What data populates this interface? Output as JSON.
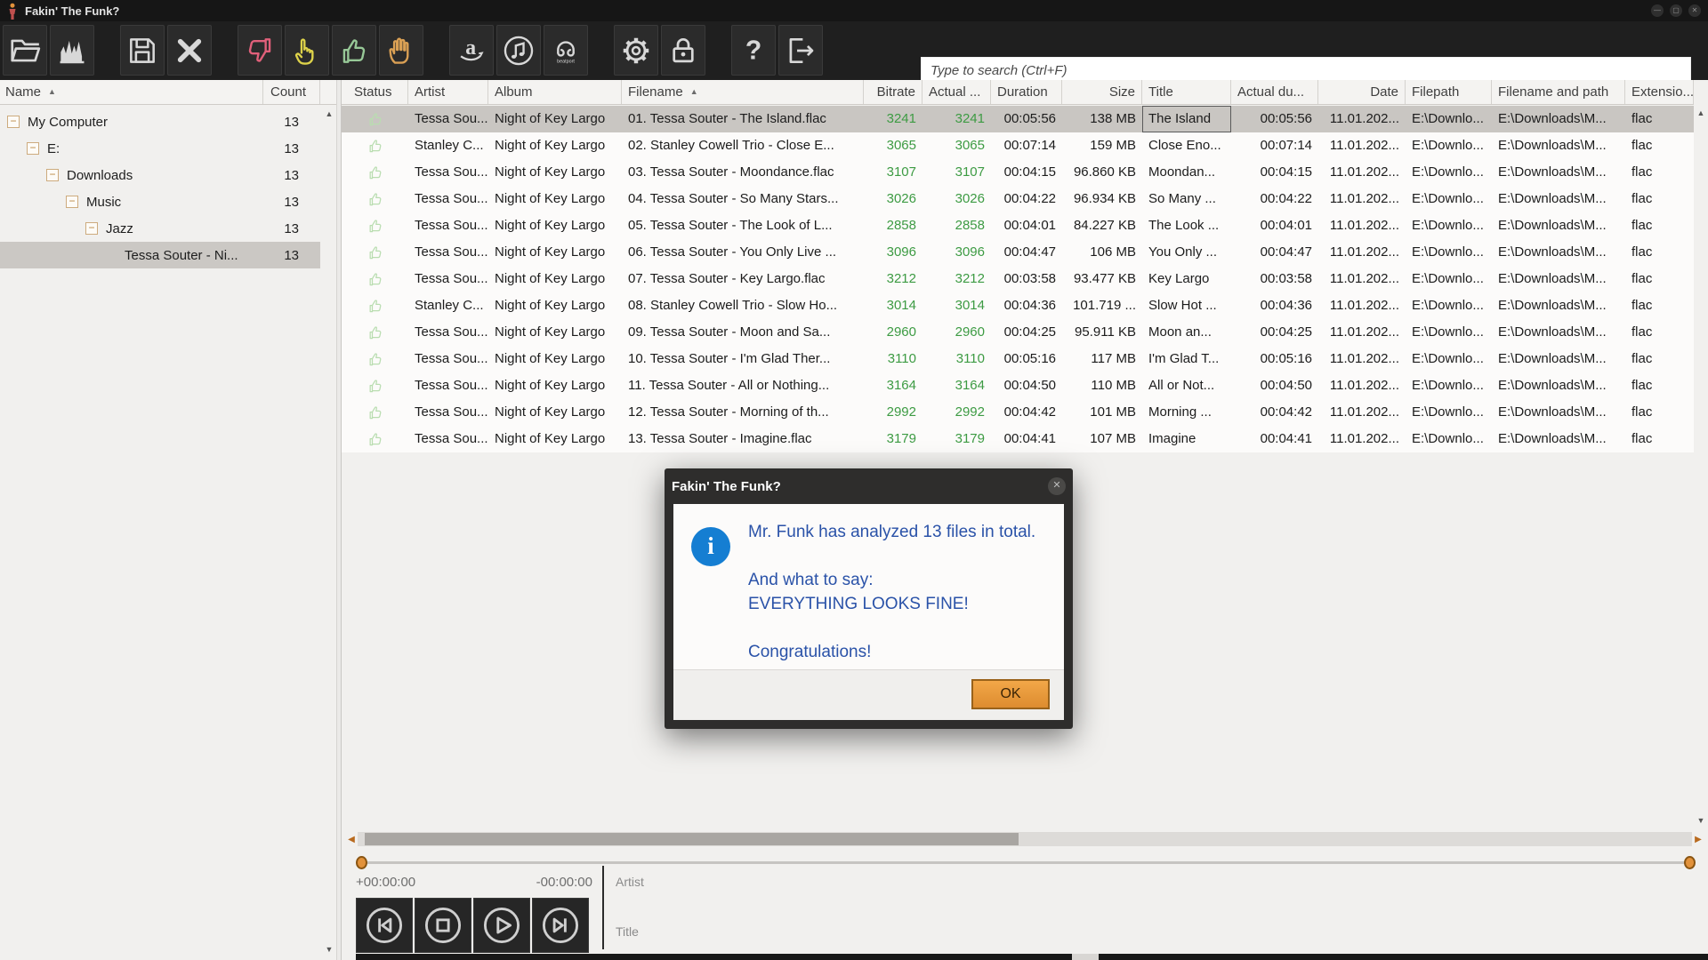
{
  "window": {
    "title": "Fakin' The Funk?",
    "controls": [
      {
        "name": "minimize-button",
        "glyph": "—"
      },
      {
        "name": "maximize-button",
        "glyph": "▢"
      },
      {
        "name": "close-button",
        "glyph": "✕"
      }
    ]
  },
  "glyphs": {
    "sort_asc": "▲",
    "scroll_up": "▲",
    "scroll_down": "▼",
    "scroll_left": "◀",
    "scroll_right": "▶",
    "minus": "−",
    "info": "i",
    "dialog_close": "✕"
  },
  "toolbar": {
    "search": {
      "placeholder": "Type to search (Ctrl+F)",
      "value": ""
    },
    "groups": [
      [
        {
          "name": "open-folder-button",
          "icon": "folder-icon"
        },
        {
          "name": "spectrum-button",
          "icon": "chart-icon"
        }
      ],
      [
        {
          "name": "save-button",
          "icon": "floppy-icon"
        },
        {
          "name": "delete-button",
          "icon": "x-icon"
        }
      ],
      [
        {
          "name": "thumbs-down-button",
          "icon": "thumb-down-icon",
          "color": "#E0607A"
        },
        {
          "name": "pointing-hand-button",
          "icon": "point-hand-icon",
          "color": "#DDD24A"
        },
        {
          "name": "thumbs-up-button",
          "icon": "thumb-up-icon",
          "color": "#97C897"
        },
        {
          "name": "raised-hand-button",
          "icon": "stop-hand-icon",
          "color": "#DAA054"
        }
      ],
      [
        {
          "name": "amazon-button",
          "icon": "amazon-icon"
        },
        {
          "name": "itunes-button",
          "icon": "itunes-icon"
        },
        {
          "name": "beatport-button",
          "icon": "beatport-icon"
        }
      ],
      [
        {
          "name": "settings-button",
          "icon": "gear-icon"
        },
        {
          "name": "lock-button",
          "icon": "lock-icon"
        }
      ],
      [
        {
          "name": "help-button",
          "icon": "help-icon"
        },
        {
          "name": "exit-button",
          "icon": "exit-icon"
        }
      ]
    ]
  },
  "tree": {
    "header": {
      "name": "Name",
      "count": "Count"
    },
    "items": [
      {
        "label": "My Computer",
        "count": "13",
        "level": 0,
        "expandable": true
      },
      {
        "label": "E:",
        "count": "13",
        "level": 1,
        "expandable": true
      },
      {
        "label": "Downloads",
        "count": "13",
        "level": 2,
        "expandable": true
      },
      {
        "label": "Music",
        "count": "13",
        "level": 3,
        "expandable": true
      },
      {
        "label": "Jazz",
        "count": "13",
        "level": 4,
        "expandable": true
      },
      {
        "label": "Tessa Souter - Ni...",
        "count": "13",
        "level": 5,
        "expandable": false,
        "selected": true
      }
    ]
  },
  "table": {
    "columns": [
      {
        "id": "status",
        "label": "Status"
      },
      {
        "id": "artist",
        "label": "Artist"
      },
      {
        "id": "album",
        "label": "Album"
      },
      {
        "id": "filename",
        "label": "Filename",
        "sorted": true
      },
      {
        "id": "bitrate",
        "label": "Bitrate",
        "align": "right",
        "header_align": "right",
        "green": true
      },
      {
        "id": "actual_bitrate",
        "label": "Actual ...",
        "align": "right",
        "green": true
      },
      {
        "id": "duration",
        "label": "Duration",
        "align": "right"
      },
      {
        "id": "size",
        "label": "Size",
        "align": "right",
        "header_align": "right"
      },
      {
        "id": "title",
        "label": "Title"
      },
      {
        "id": "actual_duration",
        "label": "Actual du...",
        "align": "right"
      },
      {
        "id": "date",
        "label": "Date",
        "align": "right",
        "header_align": "right"
      },
      {
        "id": "filepath",
        "label": "Filepath"
      },
      {
        "id": "filename_and_path",
        "label": "Filename and path"
      },
      {
        "id": "extension",
        "label": "Extensio..."
      }
    ],
    "rows": [
      {
        "status": "thumbs-up",
        "artist": "Tessa Sou...",
        "album": "Night of Key Largo",
        "filename": "01. Tessa Souter - The Island.flac",
        "bitrate": "3241",
        "actual_bitrate": "3241",
        "duration": "00:05:56",
        "size": "138 MB",
        "title": "The Island",
        "actual_duration": "00:05:56",
        "date": "11.01.202...",
        "filepath": "E:\\Downlo...",
        "filename_and_path": "E:\\Downloads\\M...",
        "extension": "flac",
        "selected": true
      },
      {
        "status": "thumbs-up",
        "artist": "Stanley C...",
        "album": "Night of Key Largo",
        "filename": "02. Stanley Cowell Trio - Close E...",
        "bitrate": "3065",
        "actual_bitrate": "3065",
        "duration": "00:07:14",
        "size": "159 MB",
        "title": "Close Eno...",
        "actual_duration": "00:07:14",
        "date": "11.01.202...",
        "filepath": "E:\\Downlo...",
        "filename_and_path": "E:\\Downloads\\M...",
        "extension": "flac"
      },
      {
        "status": "thumbs-up",
        "artist": "Tessa Sou...",
        "album": "Night of Key Largo",
        "filename": "03. Tessa Souter - Moondance.flac",
        "bitrate": "3107",
        "actual_bitrate": "3107",
        "duration": "00:04:15",
        "size": "96.860 KB",
        "title": "Moondan...",
        "actual_duration": "00:04:15",
        "date": "11.01.202...",
        "filepath": "E:\\Downlo...",
        "filename_and_path": "E:\\Downloads\\M...",
        "extension": "flac"
      },
      {
        "status": "thumbs-up",
        "artist": "Tessa Sou...",
        "album": "Night of Key Largo",
        "filename": "04. Tessa Souter - So Many Stars...",
        "bitrate": "3026",
        "actual_bitrate": "3026",
        "duration": "00:04:22",
        "size": "96.934 KB",
        "title": "So Many ...",
        "actual_duration": "00:04:22",
        "date": "11.01.202...",
        "filepath": "E:\\Downlo...",
        "filename_and_path": "E:\\Downloads\\M...",
        "extension": "flac"
      },
      {
        "status": "thumbs-up",
        "artist": "Tessa Sou...",
        "album": "Night of Key Largo",
        "filename": "05. Tessa Souter - The Look of L...",
        "bitrate": "2858",
        "actual_bitrate": "2858",
        "duration": "00:04:01",
        "size": "84.227 KB",
        "title": "The Look ...",
        "actual_duration": "00:04:01",
        "date": "11.01.202...",
        "filepath": "E:\\Downlo...",
        "filename_and_path": "E:\\Downloads\\M...",
        "extension": "flac"
      },
      {
        "status": "thumbs-up",
        "artist": "Tessa Sou...",
        "album": "Night of Key Largo",
        "filename": "06. Tessa Souter - You Only Live ...",
        "bitrate": "3096",
        "actual_bitrate": "3096",
        "duration": "00:04:47",
        "size": "106 MB",
        "title": "You Only ...",
        "actual_duration": "00:04:47",
        "date": "11.01.202...",
        "filepath": "E:\\Downlo...",
        "filename_and_path": "E:\\Downloads\\M...",
        "extension": "flac"
      },
      {
        "status": "thumbs-up",
        "artist": "Tessa Sou...",
        "album": "Night of Key Largo",
        "filename": "07. Tessa Souter - Key Largo.flac",
        "bitrate": "3212",
        "actual_bitrate": "3212",
        "duration": "00:03:58",
        "size": "93.477 KB",
        "title": "Key Largo",
        "actual_duration": "00:03:58",
        "date": "11.01.202...",
        "filepath": "E:\\Downlo...",
        "filename_and_path": "E:\\Downloads\\M...",
        "extension": "flac"
      },
      {
        "status": "thumbs-up",
        "artist": "Stanley C...",
        "album": "Night of Key Largo",
        "filename": "08. Stanley Cowell Trio - Slow Ho...",
        "bitrate": "3014",
        "actual_bitrate": "3014",
        "duration": "00:04:36",
        "size": "101.719 ...",
        "title": "Slow Hot ...",
        "actual_duration": "00:04:36",
        "date": "11.01.202...",
        "filepath": "E:\\Downlo...",
        "filename_and_path": "E:\\Downloads\\M...",
        "extension": "flac"
      },
      {
        "status": "thumbs-up",
        "artist": "Tessa Sou...",
        "album": "Night of Key Largo",
        "filename": "09. Tessa Souter - Moon and Sa...",
        "bitrate": "2960",
        "actual_bitrate": "2960",
        "duration": "00:04:25",
        "size": "95.911 KB",
        "title": "Moon an...",
        "actual_duration": "00:04:25",
        "date": "11.01.202...",
        "filepath": "E:\\Downlo...",
        "filename_and_path": "E:\\Downloads\\M...",
        "extension": "flac"
      },
      {
        "status": "thumbs-up",
        "artist": "Tessa Sou...",
        "album": "Night of Key Largo",
        "filename": "10. Tessa Souter - I'm Glad Ther...",
        "bitrate": "3110",
        "actual_bitrate": "3110",
        "duration": "00:05:16",
        "size": "117 MB",
        "title": "I'm Glad T...",
        "actual_duration": "00:05:16",
        "date": "11.01.202...",
        "filepath": "E:\\Downlo...",
        "filename_and_path": "E:\\Downloads\\M...",
        "extension": "flac"
      },
      {
        "status": "thumbs-up",
        "artist": "Tessa Sou...",
        "album": "Night of Key Largo",
        "filename": "11. Tessa Souter - All or Nothing...",
        "bitrate": "3164",
        "actual_bitrate": "3164",
        "duration": "00:04:50",
        "size": "110 MB",
        "title": "All or Not...",
        "actual_duration": "00:04:50",
        "date": "11.01.202...",
        "filepath": "E:\\Downlo...",
        "filename_and_path": "E:\\Downloads\\M...",
        "extension": "flac"
      },
      {
        "status": "thumbs-up",
        "artist": "Tessa Sou...",
        "album": "Night of Key Largo",
        "filename": "12. Tessa Souter - Morning of th...",
        "bitrate": "2992",
        "actual_bitrate": "2992",
        "duration": "00:04:42",
        "size": "101 MB",
        "title": "Morning ...",
        "actual_duration": "00:04:42",
        "date": "11.01.202...",
        "filepath": "E:\\Downlo...",
        "filename_and_path": "E:\\Downloads\\M...",
        "extension": "flac"
      },
      {
        "status": "thumbs-up",
        "artist": "Tessa Sou...",
        "album": "Night of Key Largo",
        "filename": "13. Tessa Souter - Imagine.flac",
        "bitrate": "3179",
        "actual_bitrate": "3179",
        "duration": "00:04:41",
        "size": "107 MB",
        "title": "Imagine",
        "actual_duration": "00:04:41",
        "date": "11.01.202...",
        "filepath": "E:\\Downlo...",
        "filename_and_path": "E:\\Downloads\\M...",
        "extension": "flac"
      }
    ]
  },
  "dialog": {
    "title": "Fakin' The Funk?",
    "message_lines": [
      "Mr. Funk has analyzed 13 files in total.",
      "",
      "And what to say:",
      "EVERYTHING LOOKS FINE!",
      "",
      "Congratulations!"
    ],
    "ok_label": "OK"
  },
  "player": {
    "elapsed": "+00:00:00",
    "remaining": "-00:00:00",
    "artist_label": "Artist",
    "title_label": "Title"
  },
  "colors": {
    "accent_orange": "#E2923B",
    "green_value": "#3D9B43",
    "dialog_text_blue": "#2A52A8",
    "info_icon_blue": "#157ED2",
    "status_thumb_green": "#B9DDB0",
    "selected_row_gray": "#C9C6C2"
  }
}
